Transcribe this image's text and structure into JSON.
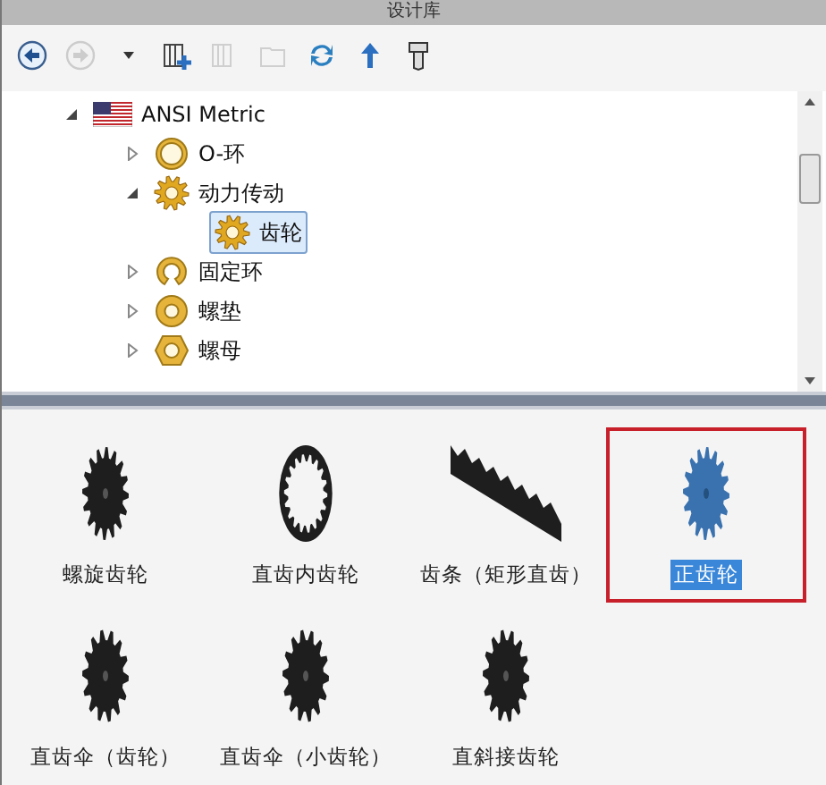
{
  "window": {
    "title": "设计库"
  },
  "toolbar": [
    {
      "kind": "back",
      "disabled": false
    },
    {
      "kind": "forward",
      "disabled": true
    },
    {
      "kind": "dropdown",
      "disabled": false
    },
    {
      "kind": "add-library",
      "disabled": false
    },
    {
      "kind": "library",
      "disabled": true
    },
    {
      "kind": "folder",
      "disabled": true
    },
    {
      "kind": "refresh",
      "disabled": false
    },
    {
      "kind": "up",
      "disabled": false
    },
    {
      "kind": "bolt",
      "disabled": false
    }
  ],
  "tree": [
    {
      "label": "ANSI Metric",
      "kind": "flag",
      "expanded": true,
      "selected": false,
      "children": [
        {
          "label": "O-环",
          "kind": "ring",
          "expanded": false,
          "selected": false
        },
        {
          "label": "动力传动",
          "kind": "gear",
          "expanded": true,
          "selected": false,
          "children": [
            {
              "label": "齿轮",
              "kind": "gear",
              "selected": true
            }
          ]
        },
        {
          "label": "固定环",
          "kind": "clip",
          "expanded": false,
          "selected": false
        },
        {
          "label": "螺垫",
          "kind": "washer",
          "expanded": false,
          "selected": false
        },
        {
          "label": "螺母",
          "kind": "nut",
          "expanded": false,
          "selected": false
        }
      ]
    }
  ],
  "items": [
    {
      "label": "螺旋齿轮",
      "kind": "helical",
      "selected": false
    },
    {
      "label": "直齿内齿轮",
      "kind": "internal",
      "selected": false
    },
    {
      "label": "齿条（矩形直齿）",
      "kind": "rack",
      "selected": false
    },
    {
      "label": "正齿轮",
      "kind": "spur",
      "selected": true
    },
    {
      "label": "直齿伞（齿轮）",
      "kind": "bevel",
      "selected": false
    },
    {
      "label": "直齿伞（小齿轮）",
      "kind": "bevel",
      "selected": false
    },
    {
      "label": "直斜接齿轮",
      "kind": "bevel",
      "selected": false
    }
  ]
}
